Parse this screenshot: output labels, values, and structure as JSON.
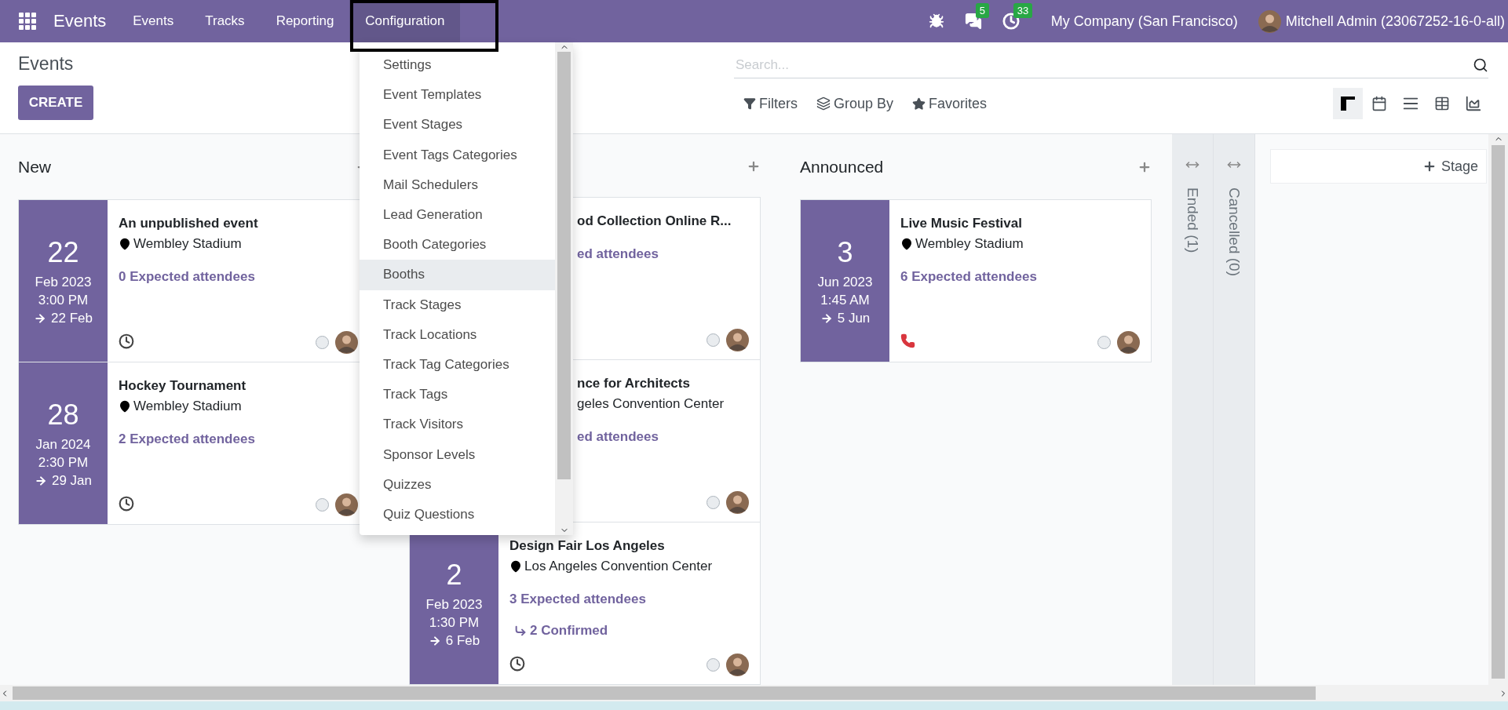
{
  "navbar": {
    "app_name": "Events",
    "menu": [
      {
        "label": "Events",
        "selected": false
      },
      {
        "label": "Tracks",
        "selected": false
      },
      {
        "label": "Reporting",
        "selected": false
      },
      {
        "label": "Configuration",
        "selected": true
      }
    ],
    "chat_count": "5",
    "activity_count": "33",
    "company": "My Company (San Francisco)",
    "user": "Mitchell Admin (23067252-16-0-all)"
  },
  "control_panel": {
    "breadcrumb": "Events",
    "create_label": "CREATE",
    "search_placeholder": "Search...",
    "filters": [
      {
        "kind": "filter",
        "label": "Filters"
      },
      {
        "kind": "groupby",
        "label": "Group By"
      },
      {
        "kind": "favorite",
        "label": "Favorites"
      }
    ],
    "views": [
      {
        "kind": "kanban",
        "selected": true
      },
      {
        "kind": "calendar",
        "selected": false
      },
      {
        "kind": "list",
        "selected": false
      },
      {
        "kind": "pivot",
        "selected": false
      },
      {
        "kind": "graph",
        "selected": false
      }
    ]
  },
  "configuration_menu": [
    {
      "label": "Settings",
      "highlighted": false
    },
    {
      "label": "Event Templates",
      "highlighted": false
    },
    {
      "label": "Event Stages",
      "highlighted": false
    },
    {
      "label": "Event Tags Categories",
      "highlighted": false
    },
    {
      "label": "Mail Schedulers",
      "highlighted": false
    },
    {
      "label": "Lead Generation",
      "highlighted": false
    },
    {
      "label": "Booth Categories",
      "highlighted": false
    },
    {
      "label": "Booths",
      "highlighted": true
    },
    {
      "label": "Track Stages",
      "highlighted": false
    },
    {
      "label": "Track Locations",
      "highlighted": false
    },
    {
      "label": "Track Tag Categories",
      "highlighted": false
    },
    {
      "label": "Track Tags",
      "highlighted": false
    },
    {
      "label": "Track Visitors",
      "highlighted": false
    },
    {
      "label": "Sponsor Levels",
      "highlighted": false
    },
    {
      "label": "Quizzes",
      "highlighted": false
    },
    {
      "label": "Quiz Questions",
      "highlighted": false
    }
  ],
  "columns": [
    {
      "title": "New",
      "cards": [
        {
          "kind": "full",
          "day": "22",
          "month_year": "Feb 2023",
          "time": "3:00 PM",
          "end": "22 Feb",
          "name": "An unpublished event",
          "location": "Wembley Stadium",
          "attendees": "0 Expected attendees",
          "activity": {
            "kind": "clock"
          }
        },
        {
          "kind": "full",
          "day": "28",
          "month_year": "Jan 2024",
          "time": "2:30 PM",
          "end": "29 Jan",
          "name": "Hockey Tournament",
          "location": "Wembley Stadium",
          "attendees": "2 Expected attendees",
          "activity": {
            "kind": "clock"
          }
        }
      ]
    },
    {
      "cards": [
        {
          "kind": "covered",
          "name": "od Collection Online R...",
          "attendees": "ed attendees"
        },
        {
          "kind": "covered",
          "name": "nce for Architects",
          "location": "geles Convention Center",
          "attendees": "ed attendees"
        },
        {
          "kind": "full",
          "day": "2",
          "month_year": "Feb 2023",
          "time": "1:30 PM",
          "end": "6 Feb",
          "name": "Design Fair Los Angeles",
          "location": "Los Angeles Convention Center",
          "attendees": "3 Expected attendees",
          "confirmed": "2 Confirmed",
          "activity": {
            "kind": "clock"
          }
        }
      ]
    },
    {
      "title": "Announced",
      "cards": [
        {
          "kind": "full",
          "day": "3",
          "month_year": "Jun 2023",
          "time": "1:45 AM",
          "end": "5 Jun",
          "name": "Live Music Festival",
          "location": "Wembley Stadium",
          "attendees": "6 Expected attendees",
          "activity": {
            "kind": "phone"
          }
        }
      ]
    }
  ],
  "folded_columns": [
    {
      "title": "Ended (1)"
    },
    {
      "title": "Cancelled (0)"
    }
  ],
  "add_stage": "Stage"
}
